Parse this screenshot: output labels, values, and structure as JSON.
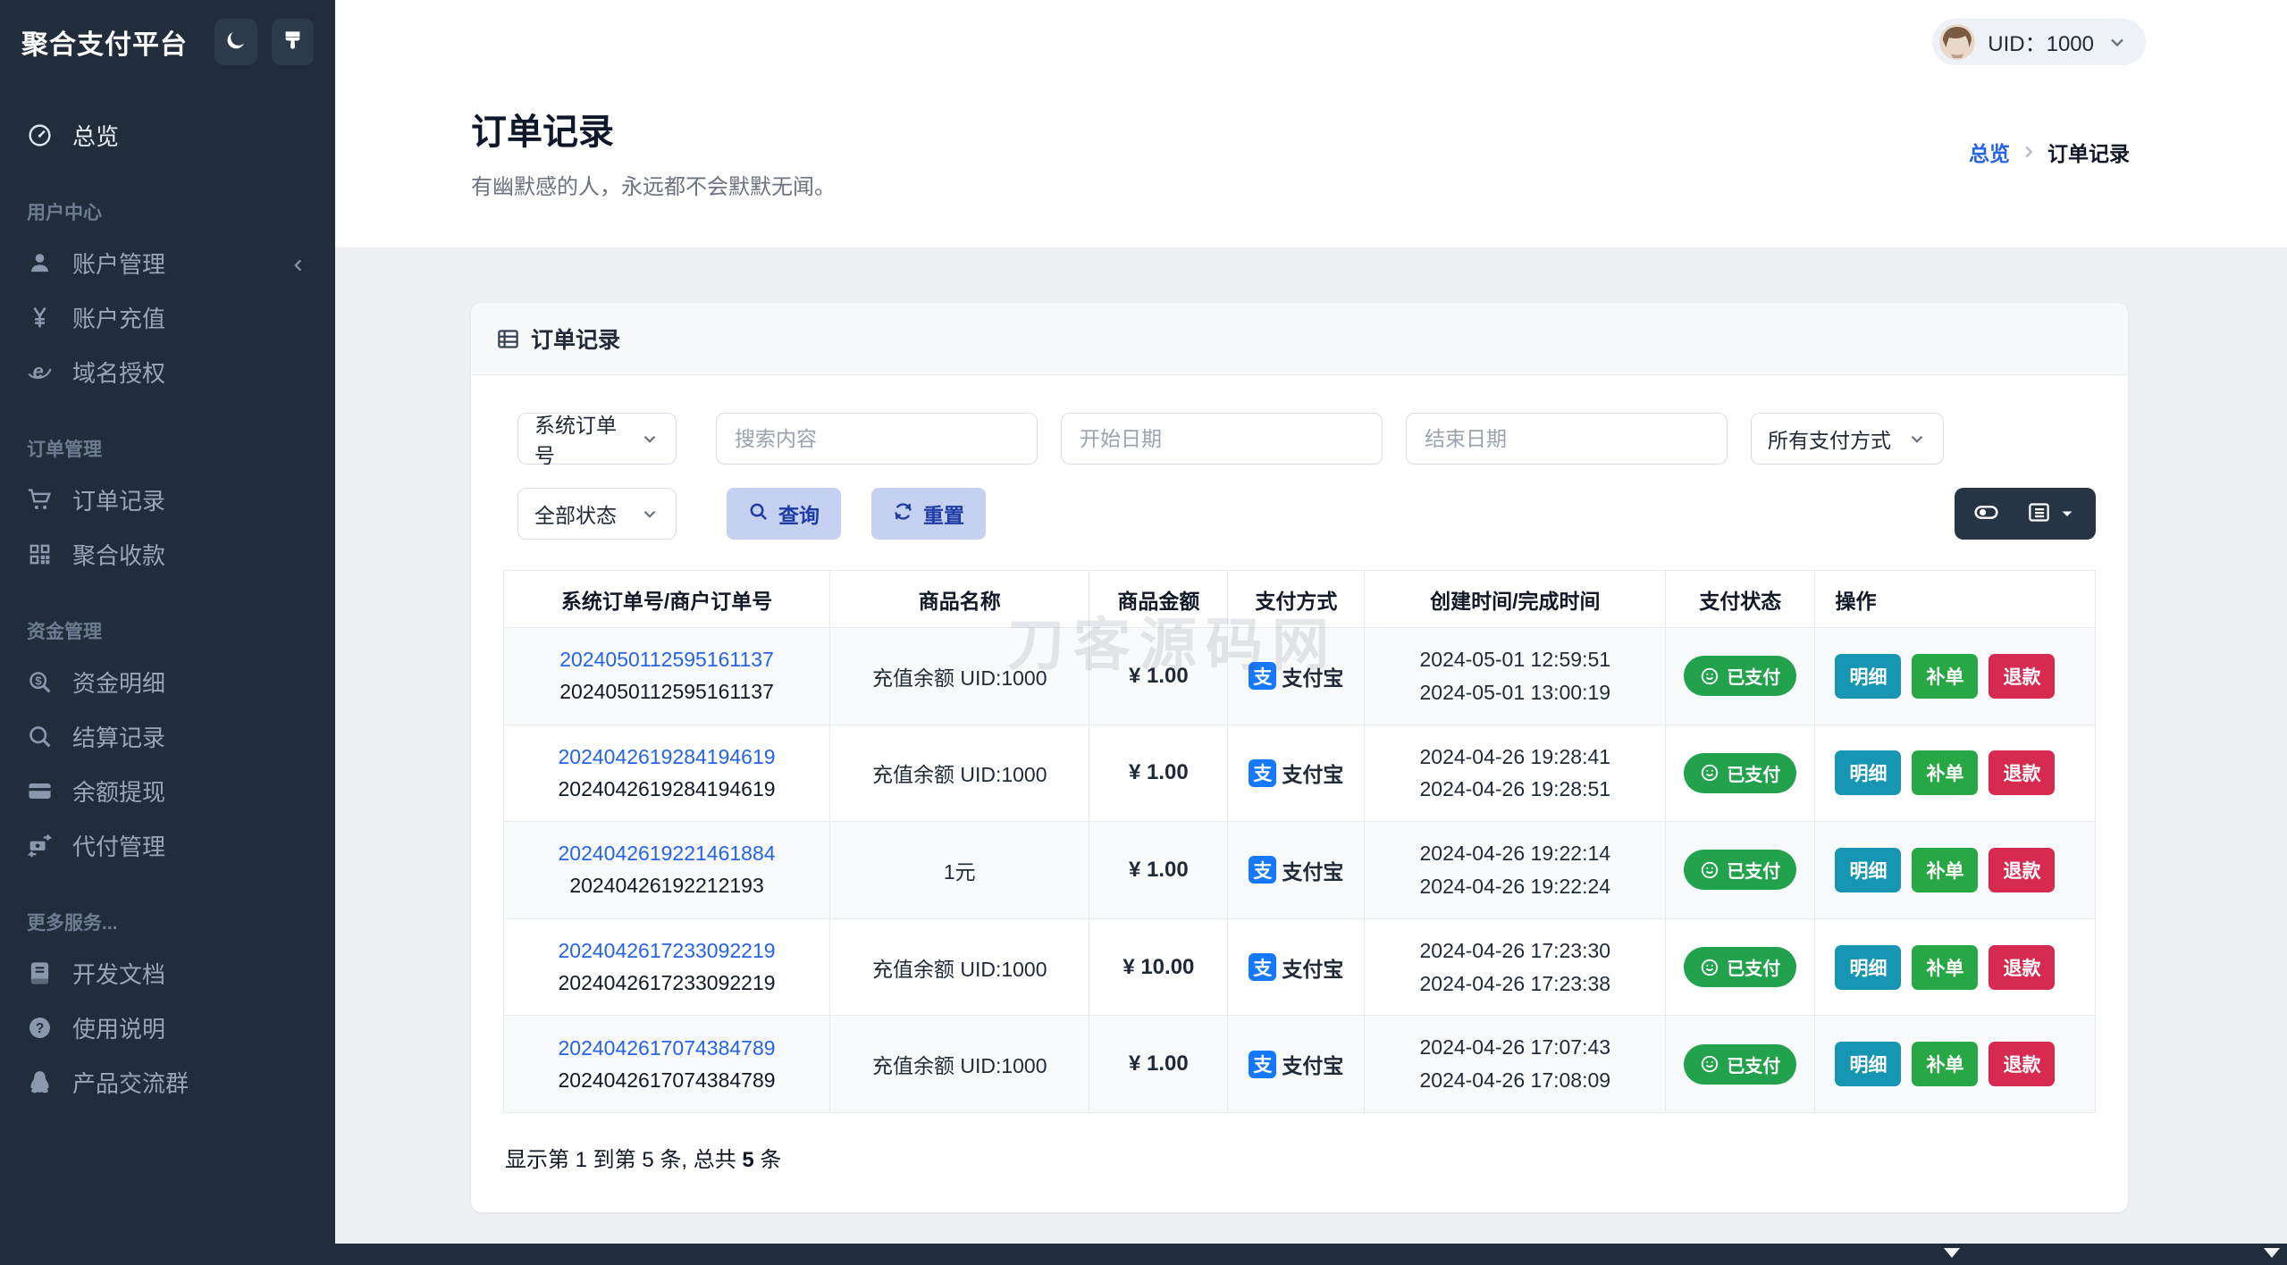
{
  "app": {
    "title": "聚合支付平台"
  },
  "topbar": {
    "uid_label": "UID：1000"
  },
  "sidebar": {
    "sections": [
      {
        "name": "main",
        "label": null,
        "items": [
          {
            "name": "overview",
            "icon": "dashboard-icon",
            "label": "总览",
            "active": true
          }
        ]
      },
      {
        "name": "user-center",
        "label": "用户中心",
        "items": [
          {
            "name": "account-management",
            "icon": "user-icon",
            "label": "账户管理",
            "collapse": true
          },
          {
            "name": "account-recharge",
            "icon": "yen-icon",
            "label": "账户充值"
          },
          {
            "name": "domain-authorization",
            "icon": "globe-icon",
            "label": "域名授权"
          }
        ]
      },
      {
        "name": "order-management",
        "label": "订单管理",
        "items": [
          {
            "name": "order-records",
            "icon": "cart-icon",
            "label": "订单记录"
          },
          {
            "name": "aggregate-collection",
            "icon": "qrcode-icon",
            "label": "聚合收款"
          }
        ]
      },
      {
        "name": "fund-management",
        "label": "资金管理",
        "items": [
          {
            "name": "fund-details",
            "icon": "search-dollar-icon",
            "label": "资金明细"
          },
          {
            "name": "settlement-records",
            "icon": "search-icon",
            "label": "结算记录"
          },
          {
            "name": "balance-withdrawal",
            "icon": "credit-card-icon",
            "label": "余额提现"
          },
          {
            "name": "payout-management",
            "icon": "transfer-icon",
            "label": "代付管理"
          }
        ]
      },
      {
        "name": "more-services",
        "label": "更多服务...",
        "items": [
          {
            "name": "dev-docs",
            "icon": "book-icon",
            "label": "开发文档"
          },
          {
            "name": "usage-guide",
            "icon": "question-icon",
            "label": "使用说明"
          },
          {
            "name": "product-group",
            "icon": "penguin-icon",
            "label": "产品交流群"
          }
        ]
      }
    ]
  },
  "page": {
    "title": "订单记录",
    "subtitle": "有幽默感的人，永远都不会默默无闻。",
    "breadcrumb": {
      "link": "总览",
      "current": "订单记录"
    }
  },
  "card": {
    "header_title": "订单记录",
    "filters": {
      "order_type_value": "系统订单号",
      "search_placeholder": "搜索内容",
      "start_date_placeholder": "开始日期",
      "end_date_placeholder": "结束日期",
      "pay_method_value": "所有支付方式",
      "status_value": "全部状态",
      "query_label": "查询",
      "reset_label": "重置"
    },
    "table": {
      "headers": [
        "系统订单号/商户订单号",
        "商品名称",
        "商品金额",
        "支付方式",
        "创建时间/完成时间",
        "支付状态",
        "操作"
      ],
      "alipay_icon_text": "支",
      "rows": [
        {
          "order_no": "2024050112595161137",
          "merchant_no": "2024050112595161137",
          "product": "充值余额 UID:1000",
          "amount": "¥ 1.00",
          "pay_method": "支付宝",
          "created": "2024-05-01 12:59:51",
          "completed": "2024-05-01 13:00:19",
          "status": "已支付",
          "actions": [
            "明细",
            "补单",
            "退款"
          ]
        },
        {
          "order_no": "2024042619284194619",
          "merchant_no": "2024042619284194619",
          "product": "充值余额 UID:1000",
          "amount": "¥ 1.00",
          "pay_method": "支付宝",
          "created": "2024-04-26 19:28:41",
          "completed": "2024-04-26 19:28:51",
          "status": "已支付",
          "actions": [
            "明细",
            "补单",
            "退款"
          ]
        },
        {
          "order_no": "2024042619221461884",
          "merchant_no": "20240426192212193",
          "product": "1元",
          "amount": "¥ 1.00",
          "pay_method": "支付宝",
          "created": "2024-04-26 19:22:14",
          "completed": "2024-04-26 19:22:24",
          "status": "已支付",
          "actions": [
            "明细",
            "补单",
            "退款"
          ]
        },
        {
          "order_no": "2024042617233092219",
          "merchant_no": "2024042617233092219",
          "product": "充值余额 UID:1000",
          "amount": "¥ 10.00",
          "pay_method": "支付宝",
          "created": "2024-04-26 17:23:30",
          "completed": "2024-04-26 17:23:38",
          "status": "已支付",
          "actions": [
            "明细",
            "补单",
            "退款"
          ]
        },
        {
          "order_no": "2024042617074384789",
          "merchant_no": "2024042617074384789",
          "product": "充值余额 UID:1000",
          "amount": "¥ 1.00",
          "pay_method": "支付宝",
          "created": "2024-04-26 17:07:43",
          "completed": "2024-04-26 17:08:09",
          "status": "已支付",
          "actions": [
            "明细",
            "补单",
            "退款"
          ]
        }
      ]
    },
    "footer": {
      "prefix": "显示第 1 到第 5 条, 总共 ",
      "total": "5",
      "suffix": " 条"
    }
  },
  "watermark": "刀客源码网",
  "colors": {
    "sidebar_bg": "#222d3b",
    "link_blue": "#2563eb",
    "soft_button_bg": "#c5d1f0",
    "soft_button_text": "#1f3ba6",
    "paid_green": "#23a24d",
    "detail_teal": "#1796b4",
    "reorder_green": "#28a745",
    "refund_red": "#d62a50",
    "alipay_blue": "#1677ff",
    "dark_widget": "#263444"
  }
}
